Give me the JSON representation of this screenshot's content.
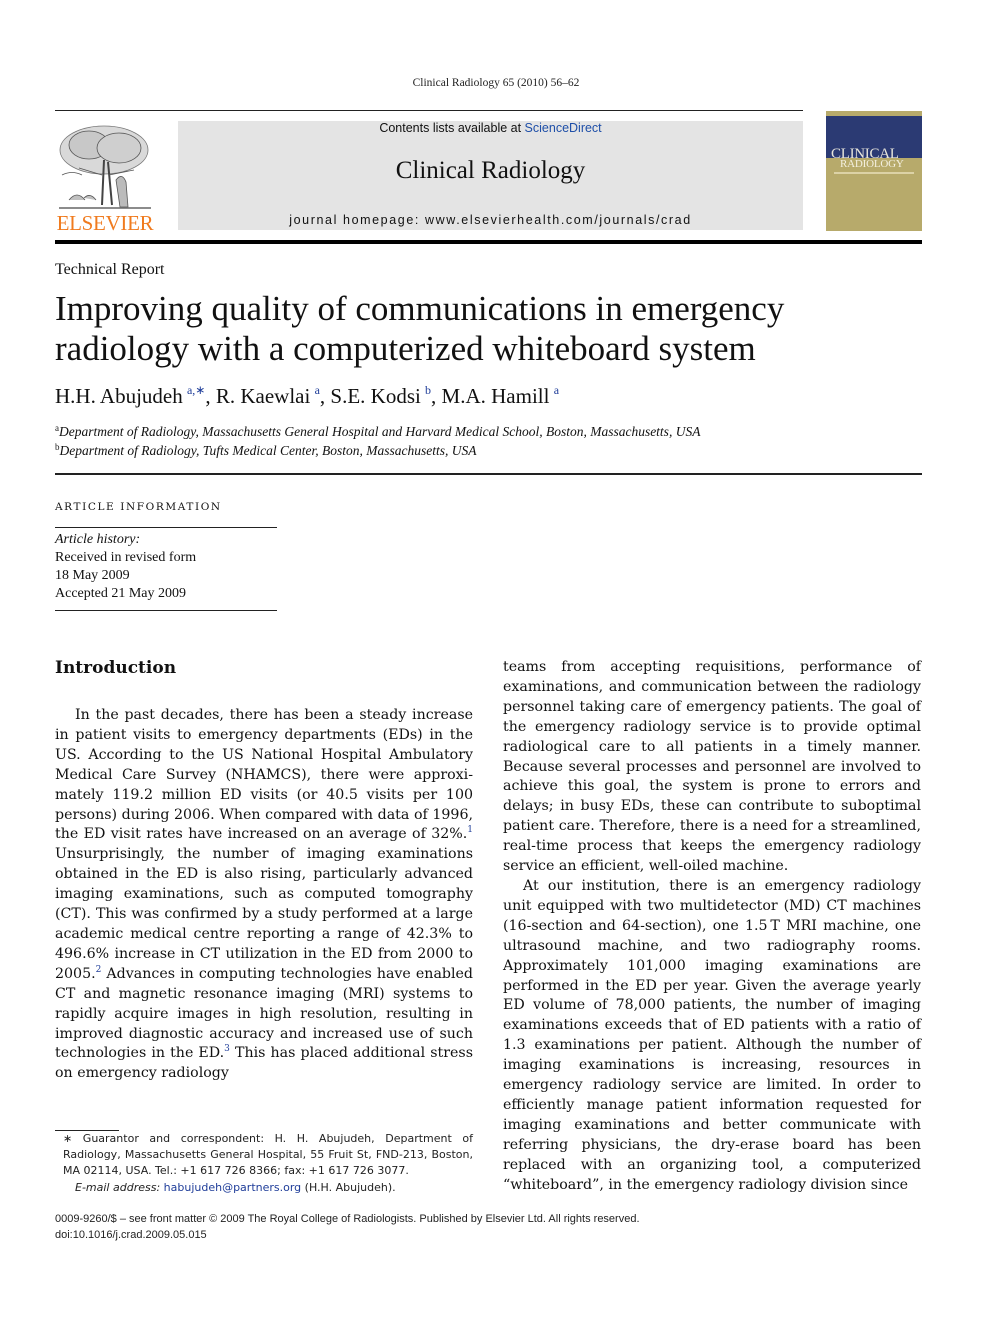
{
  "running_head": "Clinical Radiology 65 (2010) 56–62",
  "header": {
    "publisher_wordmark": "ELSEVIER",
    "contents_prefix": "Contents lists available at ",
    "contents_link": "ScienceDirect",
    "journal_name": "Clinical Radiology",
    "homepage": "journal homepage: www.elsevierhealth.com/journals/crad",
    "cover": {
      "line1": "CLINICAL",
      "line2": "RADIOLOGY"
    },
    "colors": {
      "publisher_orange": "#f07b1f",
      "link_blue": "#1f4fa8",
      "banner_gray": "#e4e4e4",
      "cover_navy": "#2b3a73",
      "cover_gold": "#b7aa6b"
    }
  },
  "article": {
    "type": "Technical Report",
    "title_line1": "Improving quality of communications in emergency",
    "title_line2": "radiology with a computerized whiteboard system",
    "authors": [
      {
        "name": "H.H. Abujudeh",
        "sup": "a,∗",
        "sep": ", "
      },
      {
        "name": "R. Kaewlai",
        "sup": "a",
        "sep": ", "
      },
      {
        "name": "S.E. Kodsi",
        "sup": "b",
        "sep": ", "
      },
      {
        "name": "M.A. Hamill",
        "sup": "a",
        "sep": ""
      }
    ],
    "affiliations": [
      {
        "mark": "a",
        "text": "Department of Radiology, Massachusetts General Hospital and Harvard Medical School, Boston, Massachusetts, USA"
      },
      {
        "mark": "b",
        "text": "Department of Radiology, Tufts Medical Center, Boston, Massachusetts, USA"
      }
    ]
  },
  "article_info": {
    "heading": "ARTICLE INFORMATION",
    "history_label": "Article history:",
    "lines": [
      "Received in revised form",
      "18 May 2009",
      "Accepted 21 May 2009"
    ]
  },
  "body": {
    "section_heading": "Introduction",
    "left": {
      "p1_a": "In the past decades, there has been a steady increase in patient visits to emergency departments (EDs) in the US. According to the US National Hospital Ambulatory Medical Care Survey (NHAMCS), there were approxi­mately 119.2 million ED visits (or 40.5 visits per 100 persons) during 2006. When compared with data of 1996, the ED visit rates have increased on an average of 32%.",
      "ref1": "1",
      "p1_b": " Unsurprisingly, the number of imaging examina­tions obtained in the ED is also rising, particularly advanced imaging examinations, such as computed tomography (CT). This was confirmed by a study per­formed at a large academic medical centre reporting a range of 42.3% to 496.6% increase in CT utilization in the ED from 2000 to 2005.",
      "ref2": "2",
      "p1_c": " Advances in computing technologies have enabled CT and magnetic resonance imaging (MRI) systems to rapidly acquire images in high resolution, resulting in improved diagnostic accuracy and increased use of such technologies in the ED.",
      "ref3": "3",
      "p1_d": " This has placed additional stress on emergency radiology"
    },
    "right": {
      "p1": "teams from accepting requisitions, performance of examinations, and communication between the radi­ology personnel taking care of emergency patients. The goal of the emergency radiology service is to provide optimal radiological care to all patients in a timely manner. Because several processes and personnel are involved to achieve this goal, the system is prone to errors and delays; in busy EDs, these can contribute to suboptimal patient care. Therefore, there is a need for a streamlined, real-time process that keeps the emer­gency radiology service an efficient, well-oiled machine.",
      "p2": "At our institution, there is an emergency radiology unit equipped with two multidetector (MD) CT machines (16-section and 64-section), one 1.5 T MRI machine, one ultrasound machine, and two radiography rooms. Approximately 101,000 imaging examinations are performed in the ED per year. Given the average yearly ED volume of 78,000 patients, the number of imaging examinations exceeds that of ED patients with a ratio of 1.3 examinations per patient. Although the number of imaging examinations is increasing, resources in emergency radiology service are limited. In order to efficiently manage patient information requested for imaging examinations and better communicate with referring physicians, the dry-erase board has been replaced with an organizing tool, a computerized “whiteboard”, in the emergency radiology division since"
    }
  },
  "footnote": {
    "star_text": "∗ Guarantor and correspondent: H. H. Abujudeh, Department of Radiology, Massachusetts General Hospital, 55 Fruit St, FND-213, Boston, MA 02114, USA. Tel.: +1 617 726 8366; fax: +1 617 726 3077.",
    "email_label": "E-mail address: ",
    "email": "habujudeh@partners.org",
    "email_suffix": " (H.H. Abujudeh)."
  },
  "bottom": {
    "copyright": "0009-9260/$ – see front matter © 2009 The Royal College of Radiologists. Published by Elsevier Ltd. All rights reserved.",
    "doi": "doi:10.1016/j.crad.2009.05.015"
  }
}
